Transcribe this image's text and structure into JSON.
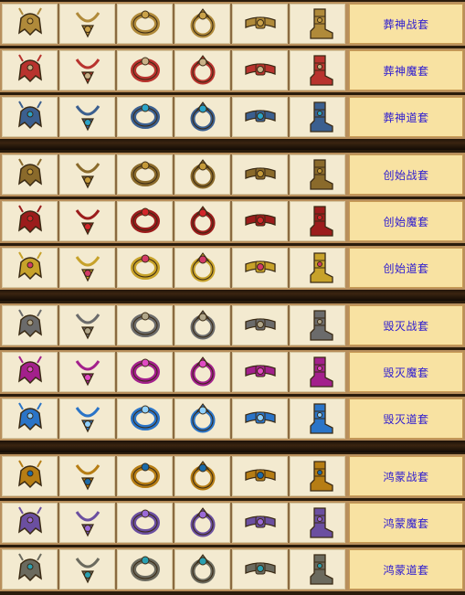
{
  "rows": [
    {
      "label": "葬神战套",
      "tint": "#b08a3a",
      "gem": "#caa24a"
    },
    {
      "label": "葬神魔套",
      "tint": "#b8332e",
      "gem": "#c9b188"
    },
    {
      "label": "葬神道套",
      "tint": "#3b5f8f",
      "gem": "#2aa3c8"
    },
    {
      "label": "创始战套",
      "tint": "#8a6a2b",
      "gem": "#c49a3a"
    },
    {
      "label": "创始魔套",
      "tint": "#9b1c1c",
      "gem": "#d2262b"
    },
    {
      "label": "创始道套",
      "tint": "#c7a22a",
      "gem": "#d23b67"
    },
    {
      "label": "毁灭战套",
      "tint": "#6b6b6b",
      "gem": "#b0a68a"
    },
    {
      "label": "毁灭魔套",
      "tint": "#a3208c",
      "gem": "#e04ac4"
    },
    {
      "label": "毁灭道套",
      "tint": "#2a74c7",
      "gem": "#8fd0ff"
    },
    {
      "label": "鸿蒙战套",
      "tint": "#b67d14",
      "gem": "#1a6aa8"
    },
    {
      "label": "鸿蒙魔套",
      "tint": "#6b4fa0",
      "gem": "#9a6ad8"
    },
    {
      "label": "鸿蒙道套",
      "tint": "#6b6a5e",
      "gem": "#2a9fb0"
    }
  ],
  "item_icons": [
    "helmet-icon",
    "necklace-icon",
    "bracelet-icon",
    "ring-icon",
    "belt-icon",
    "boots-icon"
  ]
}
